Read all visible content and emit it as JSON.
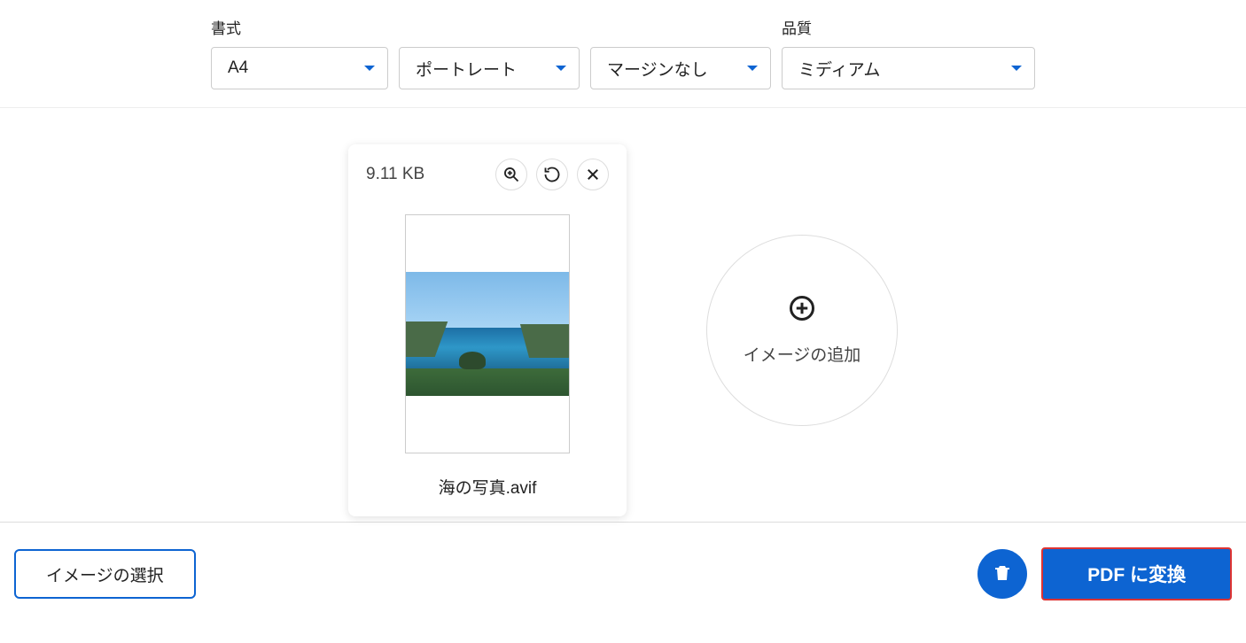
{
  "settings": {
    "format_label": "書式",
    "quality_label": "品質",
    "paper_size": "A4",
    "orientation": "ポートレート",
    "margin": "マージンなし",
    "quality": "ミディアム"
  },
  "card": {
    "file_size": "9.11 KB",
    "filename": "海の写真.avif"
  },
  "add_image_label": "イメージの追加",
  "select_images_label": "イメージの選択",
  "convert_label": "PDF に変換"
}
